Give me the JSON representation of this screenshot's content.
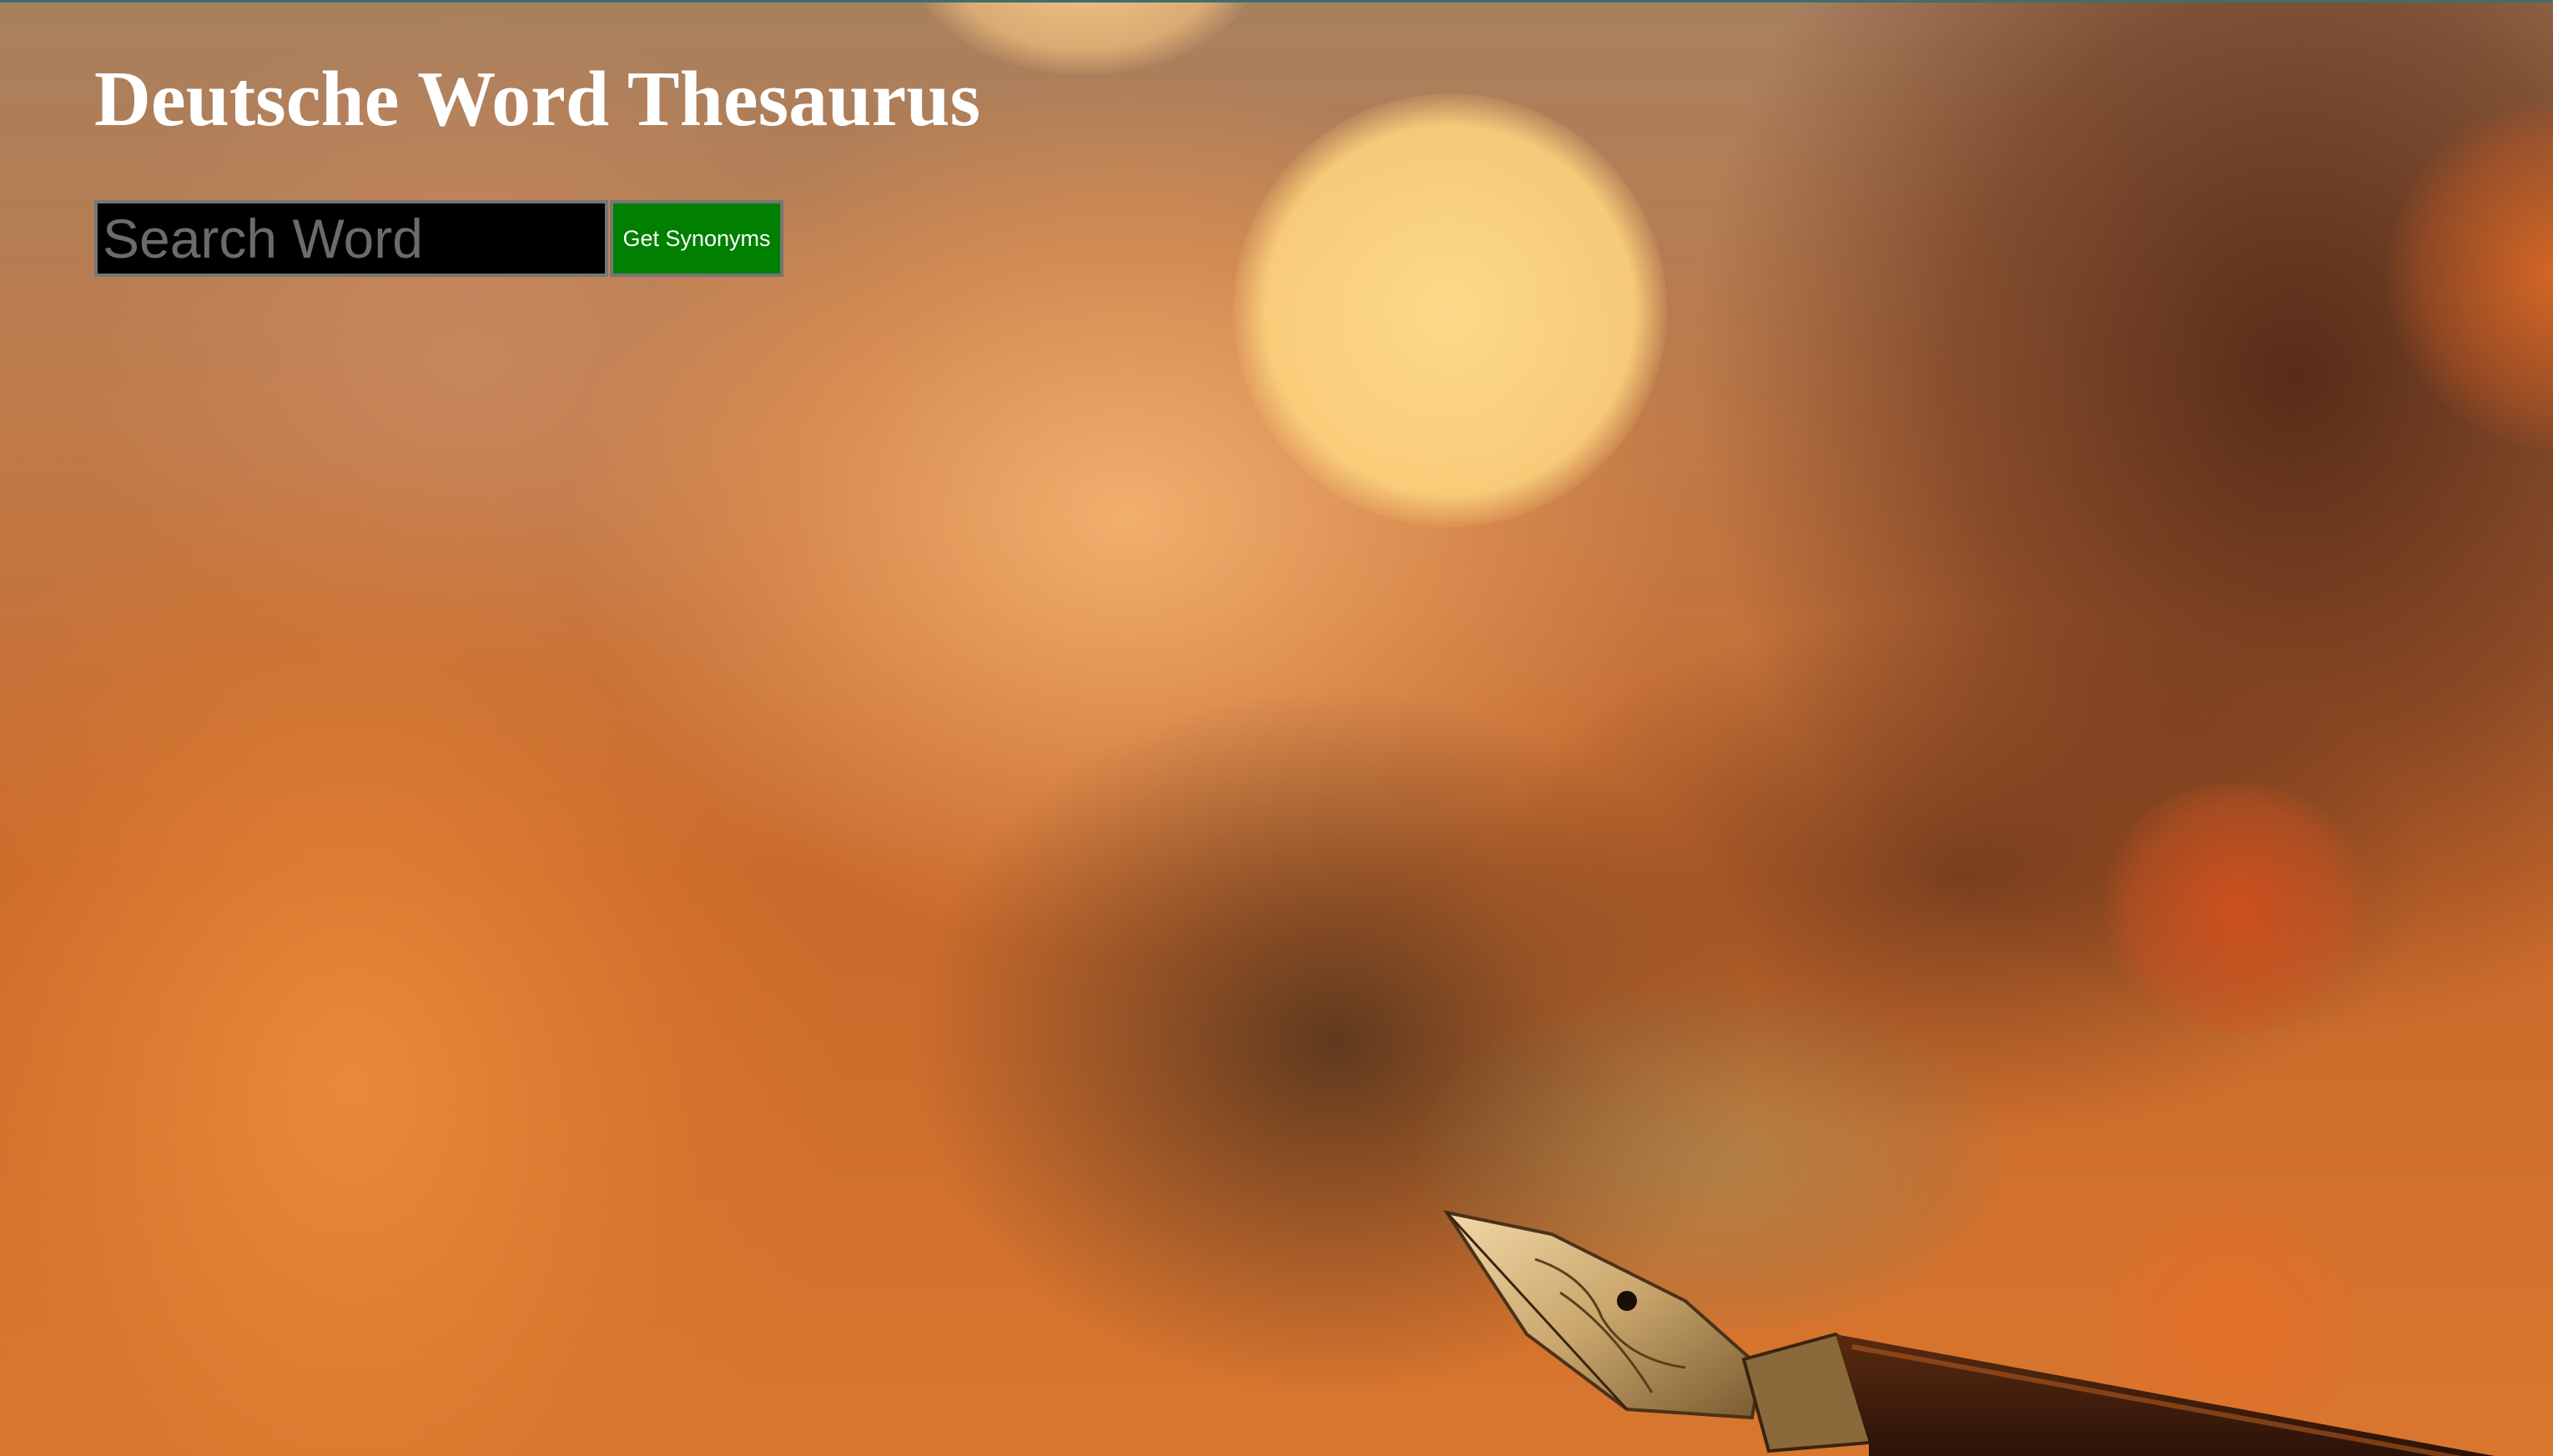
{
  "page": {
    "title": "Deutsche Word Thesaurus"
  },
  "search": {
    "placeholder": "Search Word",
    "value": "",
    "button_label": "Get Synonyms"
  },
  "colors": {
    "button_background": "#007f00",
    "input_background": "#000000",
    "title_color": "#ffffff"
  },
  "background": {
    "image": "blurred-warm-bokeh-with-fountain-pen-nib"
  }
}
